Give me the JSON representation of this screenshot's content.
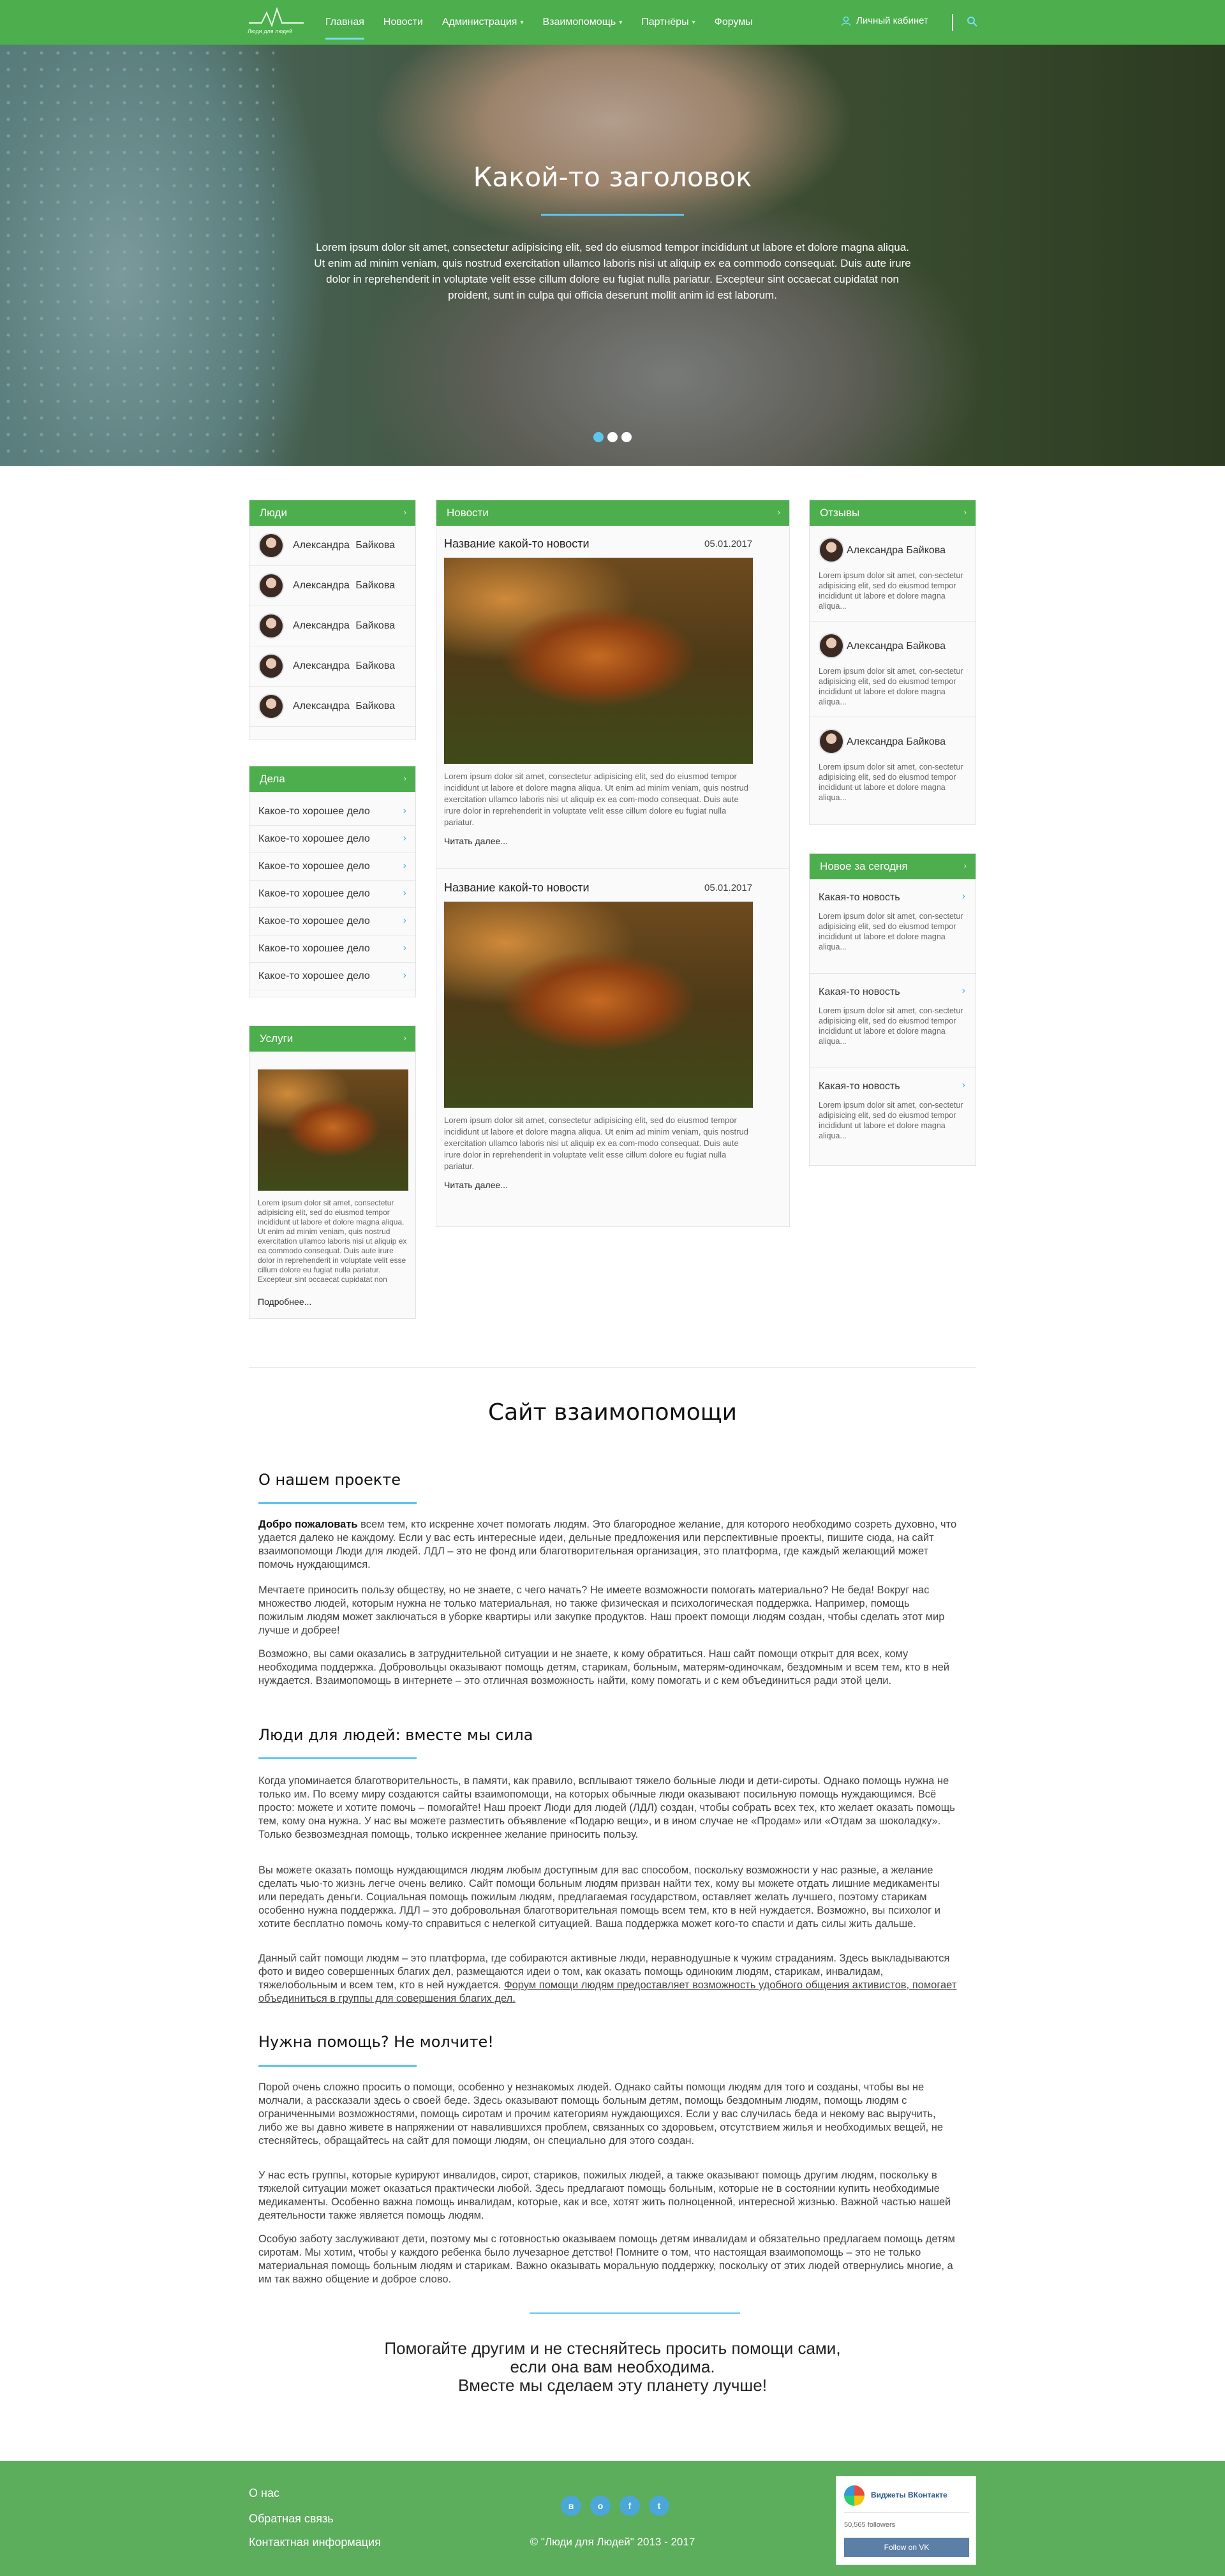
{
  "nav": {
    "logo_text": "Люди для людей",
    "items": [
      {
        "label": "Главная",
        "chevron": false
      },
      {
        "label": "Новости",
        "chevron": false
      },
      {
        "label": "Администрация",
        "chevron": true
      },
      {
        "label": "Взаимопомощь",
        "chevron": true
      },
      {
        "label": "Партнёры",
        "chevron": true
      },
      {
        "label": "Форумы",
        "chevron": false
      }
    ],
    "cabinet": "Личный кабинет"
  },
  "hero": {
    "title": "Какой-то заголовок",
    "text": "Lorem ipsum dolor sit amet, consectetur adipisicing elit, sed do eiusmod tempor incididunt ut labore et dolore magna aliqua. Ut enim ad minim veniam, quis nostrud exercitation ullamco laboris nisi ut aliquip ex ea commodo consequat. Duis aute irure dolor in reprehenderit in voluptate velit esse cillum dolore eu fugiat nulla pariatur. Excepteur sint occaecat cupidatat non proident, sunt in culpa qui officia deserunt mollit anim id est laborum.",
    "slides": 3,
    "active_slide": 1
  },
  "people": {
    "title": "Люди",
    "items": [
      "Александра Байкова",
      "Александра Байкова",
      "Александра Байкова",
      "Александра Байкова",
      "Александра Байкова"
    ]
  },
  "deals": {
    "title": "Дела",
    "items": [
      "Какое-то хорошее дело",
      "Какое-то хорошее дело",
      "Какое-то хорошее дело",
      "Какое-то хорошее дело",
      "Какое-то хорошее дело",
      "Какое-то хорошее дело",
      "Какое-то хорошее дело"
    ]
  },
  "services": {
    "title": "Услуги",
    "text": "Lorem ipsum dolor sit amet, consectetur adipisicing elit, sed do eiusmod tempor incididunt ut labore et dolore magna aliqua. Ut enim ad minim veniam, quis nostrud exercitation ullamco laboris nisi ut aliquip ex ea commodo consequat. Duis aute irure dolor in reprehenderit in voluptate velit esse cillum dolore eu fugiat nulla pariatur. Excepteur sint occaecat cupidatat non",
    "more": "Подробнее..."
  },
  "news": {
    "title": "Новости",
    "items": [
      {
        "title": "Название какой-то новости",
        "date": "05.01.2017",
        "text": "Lorem ipsum dolor sit amet, consectetur adipisicing elit, sed do eiusmod tempor incididunt ut labore et dolore magna aliqua. Ut enim ad minim veniam, quis nostrud exercitation ullamco laboris nisi ut aliquip ex ea com-modo consequat. Duis aute irure dolor in reprehenderit in voluptate velit esse cillum dolore eu fugiat nulla pariatur.",
        "more": "Читать далее..."
      },
      {
        "title": "Название какой-то новости",
        "date": "05.01.2017",
        "text": "Lorem ipsum dolor sit amet, consectetur adipisicing elit, sed do eiusmod tempor incididunt ut labore et dolore magna aliqua. Ut enim ad minim veniam, quis nostrud exercitation ullamco laboris nisi ut aliquip ex ea com-modo consequat. Duis aute irure dolor in reprehenderit in voluptate velit esse cillum dolore eu fugiat nulla pariatur.",
        "more": "Читать далее..."
      }
    ]
  },
  "reviews": {
    "title": "Отзывы",
    "items": [
      {
        "name": "Александра Байкова",
        "text": "Lorem ipsum dolor sit amet, con-sectetur adipisicing elit, sed do eiusmod tempor incididunt ut labore et dolore magna aliqua..."
      },
      {
        "name": "Александра Байкова",
        "text": "Lorem ipsum dolor sit amet, con-sectetur adipisicing elit, sed do eiusmod tempor incididunt ut labore et dolore magna aliqua..."
      },
      {
        "name": "Александра Байкова",
        "text": "Lorem ipsum dolor sit amet, con-sectetur adipisicing elit, sed do eiusmod tempor incididunt ut labore et dolore magna aliqua..."
      }
    ]
  },
  "today": {
    "title": "Новое за сегодня",
    "items": [
      {
        "title": "Какая-то новость",
        "text": "Lorem ipsum dolor sit amet, con-sectetur adipisicing elit, sed do eiusmod tempor incididunt ut labore et dolore magna aliqua..."
      },
      {
        "title": "Какая-то новость",
        "text": "Lorem ipsum dolor sit amet, con-sectetur adipisicing elit, sed do eiusmod tempor incididunt ut labore et dolore magna aliqua..."
      },
      {
        "title": "Какая-то новость",
        "text": "Lorem ipsum dolor sit amet, con-sectetur adipisicing elit, sed do eiusmod tempor incididunt ut labore et dolore magna aliqua..."
      }
    ]
  },
  "article": {
    "site_title": "Сайт взаимопомощи",
    "s1_title": "О нашем проекте",
    "s1_p1_bold": "Добро пожаловать",
    "s1_p1": " всем тем, кто искренне хочет помогать людям. Это благородное желание, для которого необходимо созреть духовно, что удается далеко не каждому. Если у вас есть интересные идеи, дельные предложения или перспективные проекты, пишите сюда, на сайт взаимопомощи Люди для людей.  ЛДЛ – это не фонд или благотворительная организация, это платформа, где каждый желающий может помочь нуждающимся.",
    "s1_p2": "Мечтаете приносить пользу обществу, но не знаете, с чего начать? Не имеете возможности помогать материально? Не беда! Вокруг нас множество людей, которым нужна не только материальная, но также физическая и психологическая поддержка. Например, помощь пожилым людям может заключаться в уборке квартиры или закупке продуктов. Наш проект помощи людям создан, чтобы сделать этот мир лучше и добрее!",
    "s1_p3": "Возможно, вы сами оказались в затруднительной ситуации и не знаете, к кому обратиться. Наш сайт помощи открыт для всех, кому необходима поддержка. Добровольцы оказывают помощь детям, старикам, больным, матерям-одиночкам, бездомным и всем тем, кто в ней нуждается. Взаимопомощь в интернете – это отличная возможность найти, кому помогать и с кем объединиться ради этой цели.",
    "s2_title": "Люди для людей: вместе мы сила",
    "s2_p1": "Когда упоминается благотворительность, в памяти, как правило, всплывают тяжело больные люди и дети-сироты. Однако помощь нужна не только им. По всему миру создаются сайты взаимопомощи, на которых обычные люди оказывают посильную помощь нуждающимся. Всё просто: можете и хотите помочь – помогайте! Наш проект Люди для людей (ЛДЛ) создан, чтобы собрать всех тех, кто желает оказать помощь тем, кому она нужна. У нас вы можете разместить объявление «Подарю вещи», и в ином случае не «Продам» или «Отдам за шоколадку». Только безвозмездная помощь, только искреннее желание приносить пользу.",
    "s2_p2": "Вы можете оказать помощь нуждающимся людям любым доступным для вас способом, поскольку возможности у нас разные, а желание сделать чью-то жизнь легче очень велико. Сайт помощи больным людям призван найти тех, кому вы можете отдать лишние медикаменты или передать деньги. Социальная помощь пожилым людям, предлагаемая государством, оставляет желать лучшего, поэтому старикам особенно нужна поддержка. ЛДЛ –  это добровольная благотворительная помощь всем тем, кто в ней нуждается. Возможно, вы психолог и хотите бесплатно помочь кому-то справиться с нелегкой ситуацией. Ваша поддержка может кого-то спасти и дать силы жить дальше.",
    "s2_p3": "Данный сайт помощи людям – это платформа, где собираются активные люди, неравнодушные к чужим страданиям. Здесь выкладываются фото и видео совершенных благих дел, размещаются идеи о том, как оказать помощь одиноким людям, старикам, инвалидам, тяжелобольным и всем тем, кто в ней нуждается. ",
    "s2_p3_link": "Форум помощи людям предоставляет возможность удобного общения активистов, помогает объединиться в группы для совершения благих дел.",
    "s3_title": "Нужна помощь? Не молчите!",
    "s3_p1": "Порой очень сложно просить о помощи, особенно у незнакомых людей. Однако сайты помощи людям для того и созданы, чтобы вы не молчали, а рассказали здесь о своей беде. Здесь оказывают помощь больным детям, помощь бездомным людям, помощь людям с ограниченными возможностями, помощь сиротам и прочим категориям нуждающихся. Если у вас случилась беда и некому вас выручить, либо же вы давно живете в напряжении от навалившихся проблем, связанных со здоровьем, отсутствием жилья и необходимых вещей, не стесняйтесь, обращайтесь на сайт для помощи людям, он специально для этого создан.",
    "s3_p2": "У нас есть группы, которые курируют инвалидов, сирот, стариков, пожилых людей, а также оказывают помощь другим людям, поскольку в тяжелой ситуации может оказаться практически любой. Здесь предлагают помощь больным, которые не в состоянии купить необходимые медикаменты. Особенно важна помощь инвалидам, которые, как и все, хотят жить полноценной, интересной жизнью. Важной частью нашей деятельности также является помощь людям.",
    "s3_p3": "Особую заботу заслуживают дети, поэтому мы с готовностью оказываем помощь детям инвалидам и обязательно предлагаем помощь детям сиротам. Мы хотим, чтобы у каждого ребенка было лучезарное детство! Помните о том, что  настоящая взаимопомощь – это не только материальная помощь больным людям и старикам. Важно оказывать моральную поддержку, поскольку от этих людей отвернулись многие, а им так важно общение и доброе слово.",
    "closing1": "Помогайте другим и не стесняйтесь просить помощи сами,",
    "closing2": "если она вам необходима.",
    "closing3": "Вместе мы сделаем эту планету лучше!"
  },
  "footer": {
    "links": [
      "О нас",
      "Обратная связь",
      "Контактная информация"
    ],
    "social_icons": [
      "vk-icon",
      "odnoklassniki-icon",
      "facebook-icon",
      "twitter-icon"
    ],
    "copyright": "© \"Люди для Людей\"  2013 - 2017",
    "vk_title": "Виджеты ВКонтакте",
    "vk_followers": "50,565 followers",
    "vk_button": "Follow on VK"
  }
}
